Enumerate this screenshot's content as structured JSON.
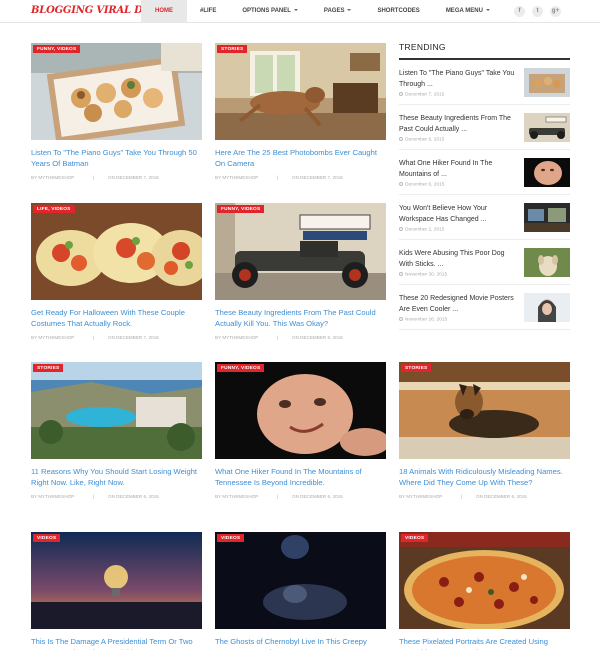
{
  "header": {
    "logo": "BLOGGING VIRAL DEMO",
    "nav": [
      "HOME",
      "#LIFE",
      "OPTIONS PANEL",
      "PAGES",
      "SHORTCODES",
      "MEGA MENU"
    ],
    "social": [
      "f",
      "t",
      "g+"
    ]
  },
  "cards": [
    {
      "category": "FUNNY, VIDEOS",
      "title": "Listen To \"The Piano Guys\" Take You Through 50 Years Of Batman",
      "author": "BY MYTHEMESHOP",
      "sep": "|",
      "date": "ON DECEMBER 7, 2015",
      "image": "tray-of-food"
    },
    {
      "category": "STORIES",
      "title": "Here Are The 25 Best Photobombs Ever Caught On Camera",
      "author": "BY MYTHEMESHOP",
      "sep": "|",
      "date": "ON DECEMBER 7, 2015",
      "image": "dog-leaping-in-room"
    },
    {
      "category": "LIFE, VIDEOS",
      "title": "Get Ready For Halloween With These Couple Costumes That Actually Rock.",
      "author": "BY MYTHEMESHOP",
      "sep": "|",
      "date": "ON DECEMBER 7, 2015",
      "image": "tacos"
    },
    {
      "category": "FUNNY, VIDEOS",
      "title": "These Beauty Ingredients From The Past Could Actually Kill You. This Was Okay?",
      "author": "BY MYTHEMESHOP",
      "sep": "|",
      "date": "ON DECEMBER 6, 2015",
      "image": "hot-rod-car"
    },
    {
      "category": "STORIES",
      "title": "11 Reasons Why You Should Start Losing Weight Right Now. Like, Right Now.",
      "author": "BY MYTHEMESHOP",
      "sep": "|",
      "date": "ON DECEMBER 6, 2015",
      "image": "coastal-resort"
    },
    {
      "category": "FUNNY, VIDEOS",
      "title": "What One Hiker Found In The Mountains of Tennessee Is Beyond Incredible.",
      "author": "BY MYTHEMESHOP",
      "sep": "|",
      "date": "ON DECEMBER 6, 2015",
      "image": "baby"
    },
    {
      "category": "STORIES",
      "title": "18 Animals With Ridiculously Misleading Names. Where Did They Come Up With These?",
      "author": "BY MYTHEMESHOP",
      "sep": "|",
      "date": "ON DECEMBER 6, 2015",
      "image": "german-shepherd"
    },
    {
      "category": "VIDEOS",
      "title": "This Is The Damage A Presidential Term Or Two Can Do. Look At These Wrinkles!",
      "author": "",
      "sep": "",
      "date": "",
      "image": "lightbulb-sunset"
    },
    {
      "category": "VIDEOS",
      "title": "The Ghosts of Chernobyl Live In This Creepy Amusement Park. See ?",
      "author": "",
      "sep": "",
      "date": "",
      "image": "dark-child"
    },
    {
      "category": "VIDEOS",
      "title": "These Pixelated Portraits Are Created Using Something Unexpected. But Genius.",
      "author": "",
      "sep": "",
      "date": "",
      "image": "pizza"
    }
  ],
  "trending": {
    "title": "TRENDING",
    "items": [
      {
        "title": "Listen To \"The Piano Guys\" Take You Through ...",
        "date": "December 7, 2015",
        "image": "tray-of-food"
      },
      {
        "title": "These Beauty Ingredients From The Past Could Actually ...",
        "date": "December 6, 2015",
        "image": "hot-rod-car"
      },
      {
        "title": "What One Hiker Found In The Mountains of ...",
        "date": "December 6, 2015",
        "image": "baby"
      },
      {
        "title": "You Won't Believe How Your Workspace Has Changed ...",
        "date": "December 2, 2015",
        "image": "workspace"
      },
      {
        "title": "Kids Were Abusing This Poor Dog With Sticks. ...",
        "date": "November 30, 2015",
        "image": "puppy"
      },
      {
        "title": "These 20 Redesigned Movie Posters Are Even Cooler ...",
        "date": "November 26, 2015",
        "image": "woman-portrait"
      }
    ]
  }
}
